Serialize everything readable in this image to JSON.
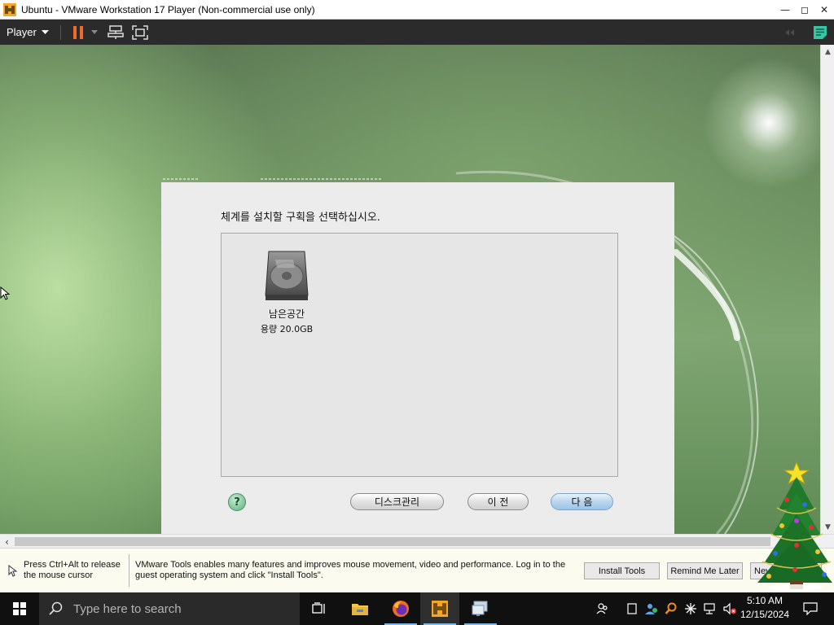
{
  "window": {
    "title": "Ubuntu - VMware Workstation 17 Player (Non-commercial use only)",
    "minimize_icon": "minimize-icon",
    "maximize_icon": "maximize-icon",
    "close_icon": "close-icon"
  },
  "toolbar": {
    "player_menu_label": "Player",
    "icons": [
      "pause-icon",
      "send-ctrl-alt-del-icon",
      "fullscreen-icon",
      "unity-icon",
      "message-log-icon"
    ]
  },
  "installer": {
    "heading": "체계를 설치할 구획을 선택하십시오.",
    "disk": {
      "name": "남은공간",
      "size": "용량 20.0GB",
      "icon": "hard-disk-icon"
    },
    "buttons": {
      "help": "?",
      "disk_manager": "디스크관리",
      "back": "이 전",
      "next": "다 음"
    }
  },
  "notification": {
    "hint": "Press Ctrl+Alt to release the mouse cursor",
    "message": "VMware Tools enables many features and improves mouse movement, video and performance. Log in to the guest operating system and click \"Install Tools\".",
    "buttons": {
      "install": "Install Tools",
      "remind": "Remind Me Later",
      "never": "Never Remind Me"
    }
  },
  "taskbar": {
    "search_placeholder": "Type here to search",
    "apps": [
      "task-view-icon",
      "file-explorer-icon",
      "firefox-icon",
      "vmware-icon",
      "remote-desktop-icon"
    ],
    "tray_icons": [
      "people-icon",
      "tablet-icon",
      "network-users-icon",
      "search-tool-icon",
      "settings-burst-icon",
      "network-icon",
      "volume-muted-icon"
    ],
    "time": "5:10 AM",
    "date": "12/15/2024"
  },
  "colors": {
    "accent": "#76b9ed",
    "toolbar_bg": "#2b2b2b",
    "desktop_green": "#6e9262"
  }
}
